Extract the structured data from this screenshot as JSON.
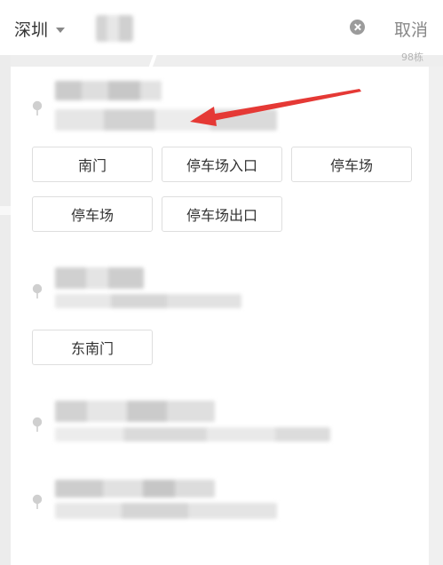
{
  "header": {
    "city": "深圳",
    "search": {
      "value": "",
      "placeholder": ""
    },
    "cancel_label": "取消"
  },
  "map": {
    "corner_label": "98栋"
  },
  "results": [
    {
      "buttons": [
        "南门",
        "停车场入口",
        "停车场",
        "停车场",
        "停车场出口"
      ]
    },
    {
      "buttons": [
        "东南门"
      ]
    },
    {
      "buttons": []
    },
    {
      "buttons": []
    }
  ],
  "icons": {
    "city_caret": "chevron-down-icon",
    "clear": "clear-icon",
    "pin": "location-pin-icon",
    "arrow": "red-arrow-annotation"
  },
  "colors": {
    "accent_annotation": "#e53935",
    "text": "#333333",
    "muted": "#888888",
    "pin": "#cfcfcf"
  }
}
